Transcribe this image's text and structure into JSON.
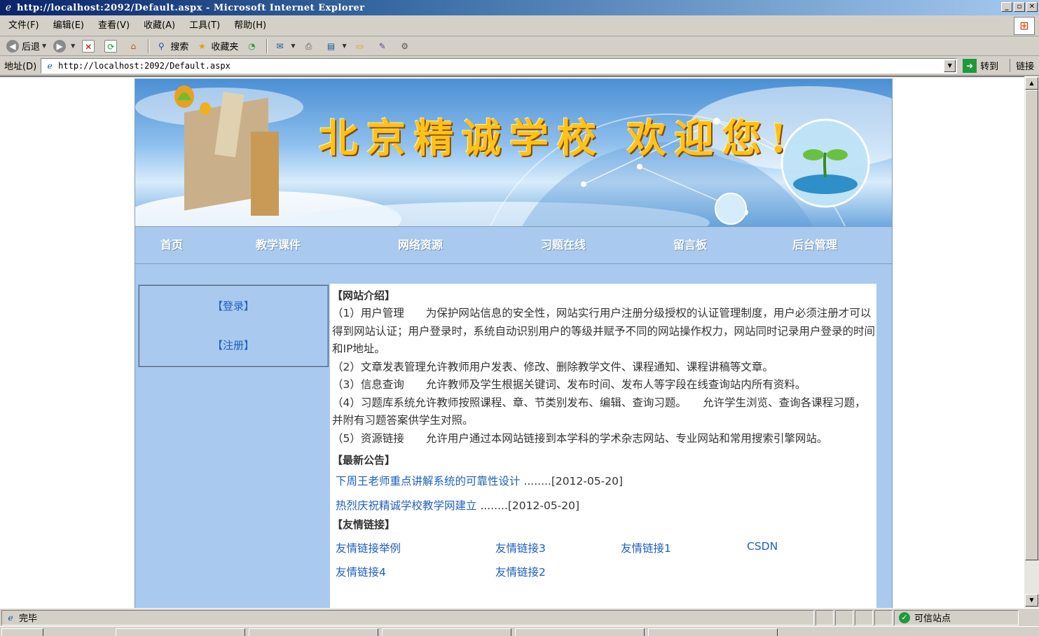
{
  "window": {
    "title": "http://localhost:2092/Default.aspx - Microsoft Internet Explorer",
    "min": "_",
    "max": "▫",
    "close": "✕"
  },
  "menubar": {
    "items": [
      "文件(F)",
      "编辑(E)",
      "查看(V)",
      "收藏(A)",
      "工具(T)",
      "帮助(H)"
    ]
  },
  "toolbar": {
    "back": "后退",
    "search": "搜索",
    "favorites": "收藏夹"
  },
  "address": {
    "label": "地址(D)",
    "url": "http://localhost:2092/Default.aspx",
    "go": "转到",
    "links": "链接"
  },
  "site": {
    "banner_title": "北京精诚学校 欢迎您!",
    "nav": [
      "首页",
      "教学课件",
      "网络资源",
      "习题在线",
      "留言板",
      "后台管理"
    ],
    "login": "【登录】",
    "register": "【注册】",
    "intro_title": "【网站介绍】",
    "intro": [
      "（1）用户管理　　为保护网站信息的安全性，网站实行用户注册分级授权的认证管理制度，用户必须注册才可以得到网站认证；用户登录时，系统自动识别用户的等级并赋予不同的网站操作权力，网站同时记录用户登录的时间和IP地址。",
      "（2）文章发表管理允许教师用户发表、修改、删除教学文件、课程通知、课程讲稿等文章。",
      "（3）信息查询　　允许教师及学生根据关键词、发布时间、发布人等字段在线查询站内所有资料。",
      "（4）习题库系统允许教师按照课程、章、节类别发布、编辑、查询习题。　　允许学生浏览、查询各课程习题，并附有习题答案供学生对照。",
      "（5）资源链接　　允许用户通过本网站链接到本学科的学术杂志网站、专业网站和常用搜索引擎网站。"
    ],
    "news_title": "【最新公告】",
    "news": [
      {
        "title": "下周王老师重点讲解系统的可靠性设计",
        "suffix": "........[2012-05-20]"
      },
      {
        "title": "热烈庆祝精诚学校教学网建立",
        "suffix": "........[2012-05-20]"
      }
    ],
    "links_title": "【友情链接】",
    "friend_links": [
      "友情链接举例",
      "友情链接3",
      "友情链接1",
      "CSDN",
      "友情链接4",
      "友情链接2"
    ]
  },
  "status": {
    "text": "完毕",
    "zone": "可信站点"
  },
  "colors": {
    "page_bg": "#a9c9ef",
    "link": "#1e5fbf",
    "banner_text": "#ffc21a"
  }
}
